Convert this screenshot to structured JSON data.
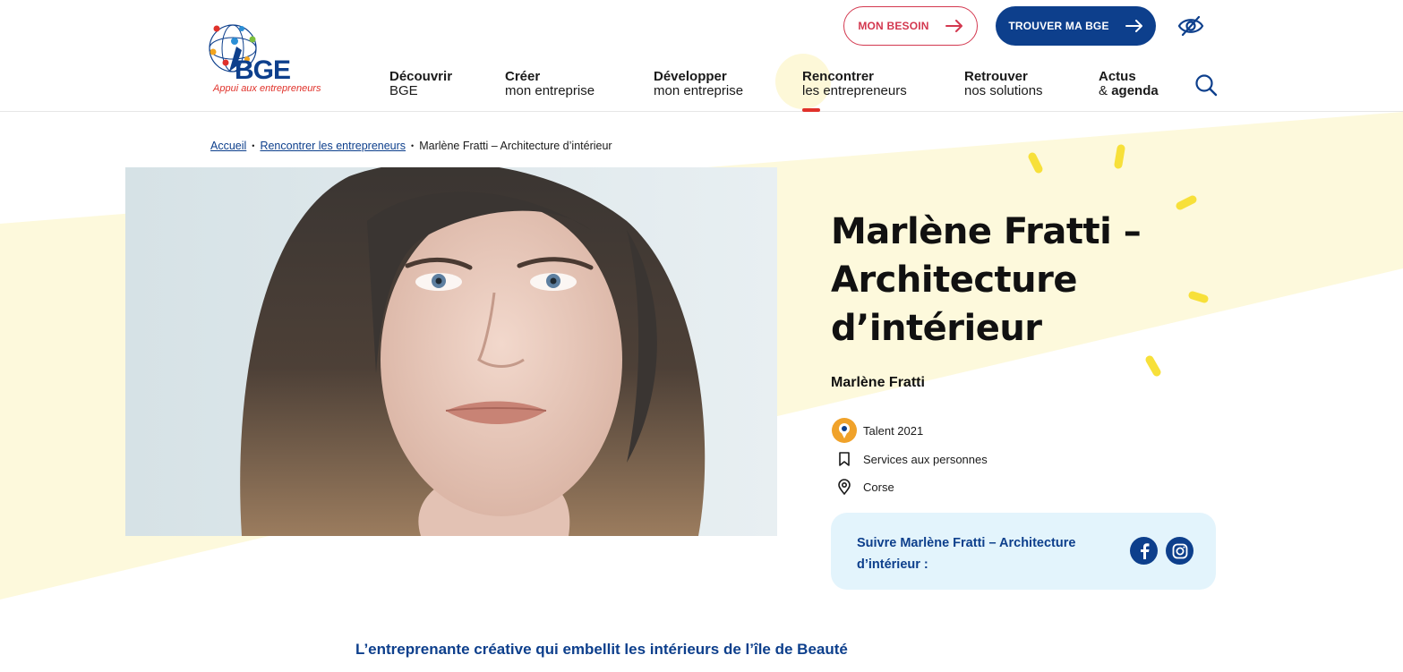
{
  "brand": {
    "name": "BGE",
    "tagline": "Appui aux entrepreneurs"
  },
  "header": {
    "besoin_label": "MON BESOIN",
    "trouver_label": "TROUVER MA BGE",
    "accessibility_icon": "eye-icon",
    "search_icon": "search-icon"
  },
  "nav": [
    {
      "line1": "Découvrir",
      "line2": "BGE"
    },
    {
      "line1": "Créer",
      "line2": "mon entreprise"
    },
    {
      "line1": "Développer",
      "line2": "mon entreprise"
    },
    {
      "line1": "Rencontrer",
      "line2": "les entrepreneurs",
      "active": true
    },
    {
      "line1": "Retrouver",
      "line2": "nos solutions"
    },
    {
      "line1": "Actus",
      "line2_prefix": "& ",
      "line2": "agenda"
    }
  ],
  "breadcrumb": {
    "home": "Accueil",
    "section": "Rencontrer les entrepreneurs",
    "current": "Marlène Fratti – Architecture d’intérieur"
  },
  "profile": {
    "title": "Marlène Fratti – Architecture d’intérieur",
    "author": "Marlène Fratti",
    "talent": "Talent 2021",
    "category": "Services aux personnes",
    "region": "Corse",
    "follow_label": "Suivre Marlène Fratti – Architecture d’intérieur :",
    "social": [
      "facebook-icon",
      "instagram-icon"
    ]
  },
  "intro": "L’entreprenante créative qui embellit les intérieurs de l’île de Beauté",
  "colors": {
    "brand_blue": "#0d3f8c",
    "accent_red": "#d3384f",
    "yellow_bg": "#fdf9d9",
    "follow_bg": "#e3f4fc"
  }
}
